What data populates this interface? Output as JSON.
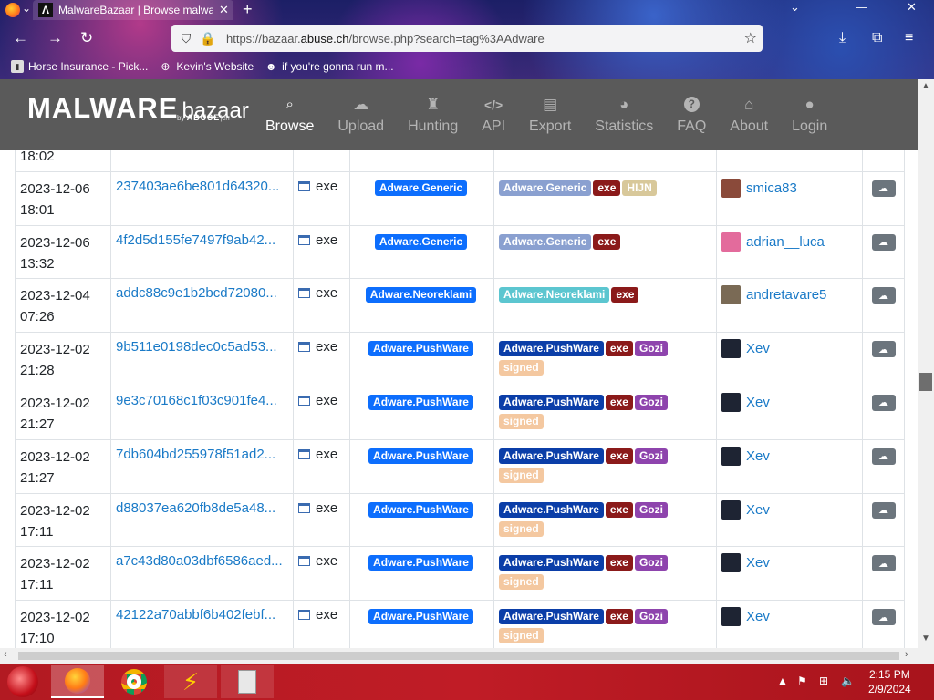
{
  "browser": {
    "tab_title": "MalwareBazaar | Browse malwa",
    "tab_favicon_letter": "Λ",
    "url_prefix": "https://bazaar.",
    "url_domain": "abuse.ch",
    "url_suffix": "/browse.php?search=tag%3AAdware",
    "bookmarks": [
      {
        "label": "Horse Insurance - Pick..."
      },
      {
        "label": "Kevin's Website"
      },
      {
        "label": "if you're gonna run m..."
      }
    ]
  },
  "site": {
    "logo_main": "MALWARE",
    "logo_sub": "bazaar",
    "logo_by": "by",
    "logo_brand": "ABUSE",
    "logo_ch": "|ch",
    "menu": [
      {
        "label": "Browse",
        "icon": "search-icon",
        "glyph": "🔍"
      },
      {
        "label": "Upload",
        "icon": "cloud-upload-icon",
        "glyph": "☁"
      },
      {
        "label": "Hunting",
        "icon": "chess-rook-icon",
        "glyph": "♜"
      },
      {
        "label": "API",
        "icon": "code-icon",
        "glyph": "</>"
      },
      {
        "label": "Export",
        "icon": "file-export-icon",
        "glyph": "🗎"
      },
      {
        "label": "Statistics",
        "icon": "pie-chart-icon",
        "glyph": "◔"
      },
      {
        "label": "FAQ",
        "icon": "question-circle-icon",
        "glyph": "?"
      },
      {
        "label": "About",
        "icon": "building-icon",
        "glyph": "⌂"
      },
      {
        "label": "Login",
        "icon": "user-icon",
        "glyph": "●"
      }
    ]
  },
  "table": {
    "rows": [
      {
        "date": "",
        "time": "18:02",
        "hash": "",
        "type": "",
        "signature": "",
        "tags": [],
        "reporter": "",
        "partial": true
      },
      {
        "date": "2023-12-06",
        "time": "18:01",
        "hash": "237403ae6be801d64320...",
        "type": "exe",
        "signature": "Adware.Generic",
        "tags": [
          {
            "label": "Adware.Generic",
            "kind": "sig-generic"
          },
          {
            "label": "exe",
            "kind": "exe"
          },
          {
            "label": "HIJN",
            "kind": "hijn"
          }
        ],
        "reporter": "smica83",
        "avatar": "#8a4a3a"
      },
      {
        "date": "2023-12-06",
        "time": "13:32",
        "hash": "4f2d5d155fe7497f9ab42...",
        "type": "exe",
        "signature": "Adware.Generic",
        "tags": [
          {
            "label": "Adware.Generic",
            "kind": "sig-generic"
          },
          {
            "label": "exe",
            "kind": "exe"
          }
        ],
        "reporter": "adrian__luca",
        "avatar": "#e36b9c"
      },
      {
        "date": "2023-12-04",
        "time": "07:26",
        "hash": "addc88c9e1b2bcd72080...",
        "type": "exe",
        "signature": "Adware.Neoreklami",
        "tags": [
          {
            "label": "Adware.Neoreklami",
            "kind": "sig-neo"
          },
          {
            "label": "exe",
            "kind": "exe"
          }
        ],
        "reporter": "andretavare5",
        "avatar": "#7a6a55"
      },
      {
        "date": "2023-12-02",
        "time": "21:28",
        "hash": "9b511e0198dec0c5ad53...",
        "type": "exe",
        "signature": "Adware.PushWare",
        "tags": [
          {
            "label": "Adware.PushWare",
            "kind": "sig-push"
          },
          {
            "label": "exe",
            "kind": "exe"
          },
          {
            "label": "Gozi",
            "kind": "gozi"
          },
          {
            "label": "signed",
            "kind": "signed"
          }
        ],
        "reporter": "Xev",
        "avatar": "#1e2433"
      },
      {
        "date": "2023-12-02",
        "time": "21:27",
        "hash": "9e3c70168c1f03c901fe4...",
        "type": "exe",
        "signature": "Adware.PushWare",
        "tags": [
          {
            "label": "Adware.PushWare",
            "kind": "sig-push"
          },
          {
            "label": "exe",
            "kind": "exe"
          },
          {
            "label": "Gozi",
            "kind": "gozi"
          },
          {
            "label": "signed",
            "kind": "signed"
          }
        ],
        "reporter": "Xev",
        "avatar": "#1e2433"
      },
      {
        "date": "2023-12-02",
        "time": "21:27",
        "hash": "7db604bd255978f51ad2...",
        "type": "exe",
        "signature": "Adware.PushWare",
        "tags": [
          {
            "label": "Adware.PushWare",
            "kind": "sig-push"
          },
          {
            "label": "exe",
            "kind": "exe"
          },
          {
            "label": "Gozi",
            "kind": "gozi"
          },
          {
            "label": "signed",
            "kind": "signed"
          }
        ],
        "reporter": "Xev",
        "avatar": "#1e2433"
      },
      {
        "date": "2023-12-02",
        "time": "17:11",
        "hash": "d88037ea620fb8de5a48...",
        "type": "exe",
        "signature": "Adware.PushWare",
        "tags": [
          {
            "label": "Adware.PushWare",
            "kind": "sig-push"
          },
          {
            "label": "exe",
            "kind": "exe"
          },
          {
            "label": "Gozi",
            "kind": "gozi"
          },
          {
            "label": "signed",
            "kind": "signed"
          }
        ],
        "reporter": "Xev",
        "avatar": "#1e2433"
      },
      {
        "date": "2023-12-02",
        "time": "17:11",
        "hash": "a7c43d80a03dbf6586aed...",
        "type": "exe",
        "signature": "Adware.PushWare",
        "tags": [
          {
            "label": "Adware.PushWare",
            "kind": "sig-push"
          },
          {
            "label": "exe",
            "kind": "exe"
          },
          {
            "label": "Gozi",
            "kind": "gozi"
          },
          {
            "label": "signed",
            "kind": "signed"
          }
        ],
        "reporter": "Xev",
        "avatar": "#1e2433"
      },
      {
        "date": "2023-12-02",
        "time": "17:10",
        "hash": "42122a70abbf6b402febf...",
        "type": "exe",
        "signature": "Adware.PushWare",
        "tags": [
          {
            "label": "Adware.PushWare",
            "kind": "sig-push"
          },
          {
            "label": "exe",
            "kind": "exe"
          },
          {
            "label": "Gozi",
            "kind": "gozi"
          },
          {
            "label": "signed",
            "kind": "signed"
          }
        ],
        "reporter": "Xev",
        "avatar": "#1e2433"
      }
    ]
  },
  "colors": {
    "sig_primary": "#0d6efd",
    "sig-generic": "#8aa0d0",
    "sig-neo": "#5cc6d0",
    "sig-push": "#0b3ea8",
    "exe": "#8b1a1a",
    "hijn": "#d8c89a",
    "gozi": "#8e44ad",
    "signed": "#f4c8a0"
  },
  "taskbar": {
    "time": "2:15 PM",
    "date": "2/9/2024"
  }
}
